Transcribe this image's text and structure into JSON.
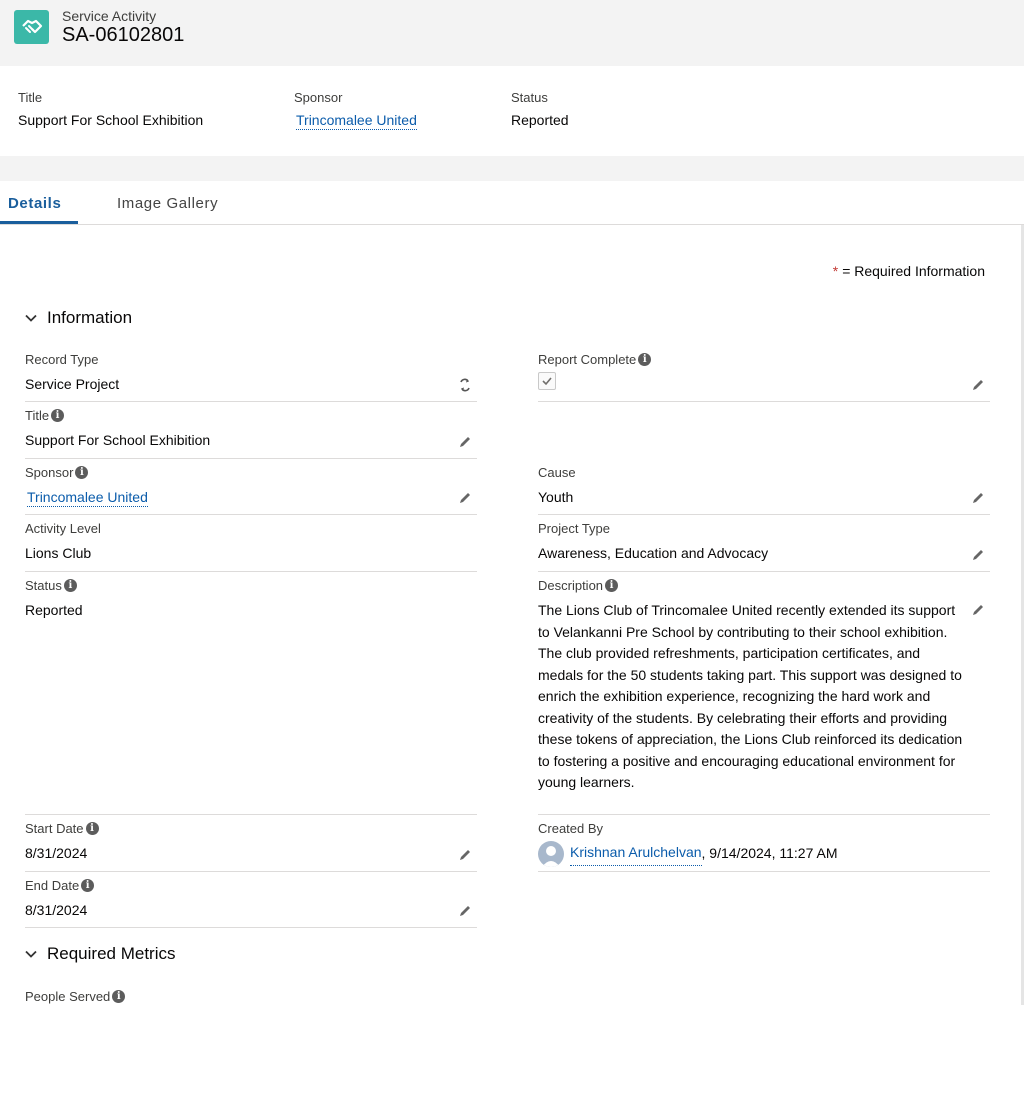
{
  "header": {
    "object_label": "Service Activity",
    "record_name": "SA-06102801",
    "object_icon": "handshake-icon",
    "icon_color": "#3bb8a8"
  },
  "highlights": {
    "title_label": "Title",
    "title_value": "Support For School Exhibition",
    "sponsor_label": "Sponsor",
    "sponsor_value": "Trincomalee United",
    "status_label": "Status",
    "status_value": "Reported"
  },
  "tabs": [
    {
      "label": "Details",
      "active": true
    },
    {
      "label": "Image Gallery",
      "active": false
    }
  ],
  "required_info": {
    "star": "*",
    "text": "= Required Information"
  },
  "sections": {
    "information": "Information",
    "required_metrics": "Required Metrics"
  },
  "fields": {
    "record_type": {
      "label": "Record Type",
      "value": "Service Project"
    },
    "report_complete": {
      "label": "Report Complete",
      "checked": true
    },
    "title": {
      "label": "Title",
      "value": "Support For School Exhibition"
    },
    "sponsor": {
      "label": "Sponsor",
      "value": "Trincomalee United"
    },
    "cause": {
      "label": "Cause",
      "value": "Youth"
    },
    "activity_level": {
      "label": "Activity Level",
      "value": "Lions Club"
    },
    "project_type": {
      "label": "Project Type",
      "value": "Awareness, Education and Advocacy"
    },
    "status": {
      "label": "Status",
      "value": "Reported"
    },
    "description": {
      "label": "Description",
      "value": "The Lions Club of Trincomalee United recently extended its support to Velankanni Pre School by contributing to their school exhibition. The club provided refreshments, participation certificates, and medals for the 50 students taking part. This support was designed to enrich the exhibition experience, recognizing the hard work and creativity of the students. By celebrating their efforts and providing these tokens of appreciation, the Lions Club reinforced its dedication to fostering a positive and encouraging educational environment for young learners."
    },
    "start_date": {
      "label": "Start Date",
      "value": "8/31/2024"
    },
    "created_by": {
      "label": "Created By",
      "user": "Krishnan Arulchelvan",
      "timestamp": ", 9/14/2024, 11:27 AM"
    },
    "end_date": {
      "label": "End Date",
      "value": "8/31/2024"
    },
    "people_served": {
      "label": "People Served"
    }
  },
  "colors": {
    "link": "#0b5cab",
    "active_tab": "#1a5e9c",
    "required_star": "#c23934"
  }
}
